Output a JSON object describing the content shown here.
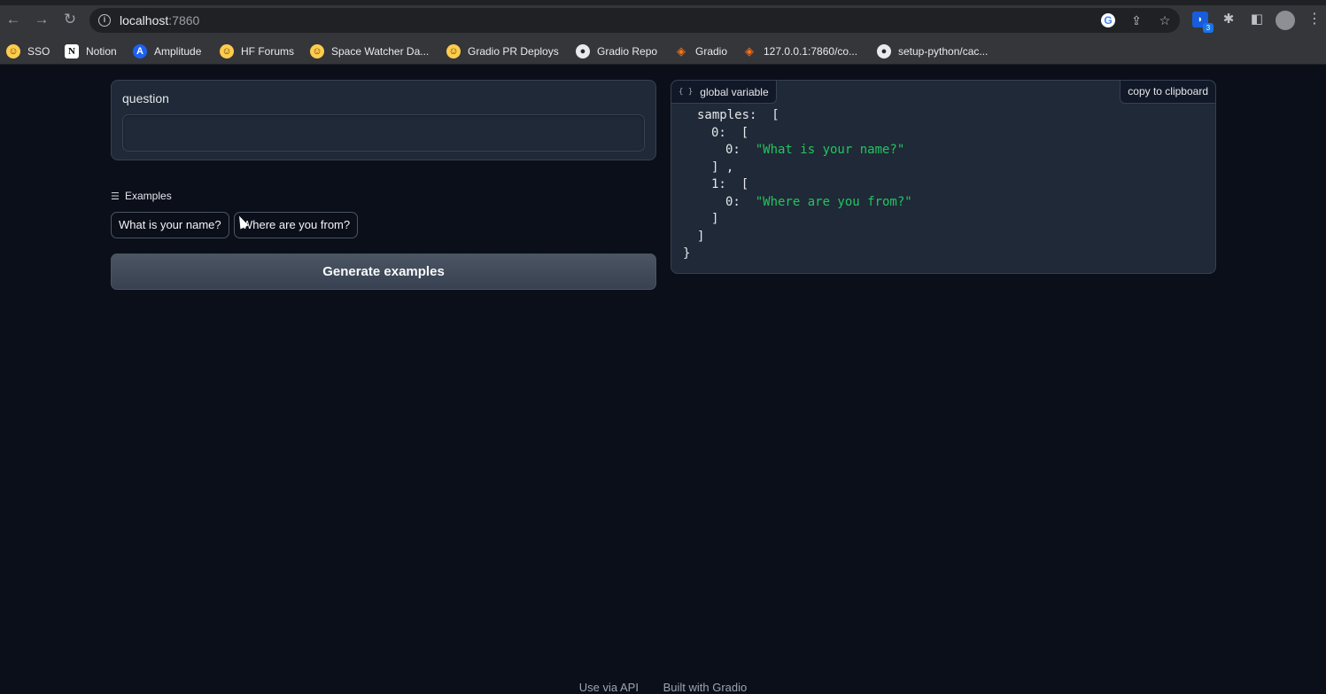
{
  "browser": {
    "url_host": "localhost",
    "url_port": ":7860",
    "extension_badge": "3",
    "bookmarks": [
      {
        "label": "SSO",
        "icon": "huggingface-icon"
      },
      {
        "label": "Notion",
        "icon": "notion-icon"
      },
      {
        "label": "Amplitude",
        "icon": "amplitude-icon"
      },
      {
        "label": "HF Forums",
        "icon": "huggingface-icon"
      },
      {
        "label": "Space Watcher Da...",
        "icon": "huggingface-icon"
      },
      {
        "label": "Gradio PR Deploys",
        "icon": "huggingface-icon"
      },
      {
        "label": "Gradio Repo",
        "icon": "github-icon"
      },
      {
        "label": "Gradio",
        "icon": "gradio-icon"
      },
      {
        "label": "127.0.0.1:7860/co...",
        "icon": "gradio-icon"
      },
      {
        "label": "setup-python/cac...",
        "icon": "github-icon"
      }
    ]
  },
  "app": {
    "textbox": {
      "label": "question",
      "value": ""
    },
    "examples": {
      "heading": "Examples",
      "items": [
        "What is your name?",
        "Where are you from?"
      ]
    },
    "generate_button": "Generate examples",
    "json_panel": {
      "label": "global variable",
      "copy_label": "copy to clipboard",
      "lines": [
        {
          "indent": 1,
          "text": "samples:  [",
          "kind": "key"
        },
        {
          "indent": 2,
          "text": "0:  [",
          "kind": "key"
        },
        {
          "indent": 3,
          "key": "0:  ",
          "value": "\"What is your name?\"",
          "kind": "pair"
        },
        {
          "indent": 2,
          "text": "] ,",
          "kind": "key"
        },
        {
          "indent": 2,
          "text": "1:  [",
          "kind": "key"
        },
        {
          "indent": 3,
          "key": "0:  ",
          "value": "\"Where are you from?\"",
          "kind": "pair"
        },
        {
          "indent": 2,
          "text": "]",
          "kind": "key"
        },
        {
          "indent": 1,
          "text": "]",
          "kind": "key"
        },
        {
          "indent": 0,
          "text": "}",
          "kind": "key"
        }
      ]
    },
    "footer": {
      "api": "Use via API",
      "built": "Built with Gradio"
    }
  }
}
